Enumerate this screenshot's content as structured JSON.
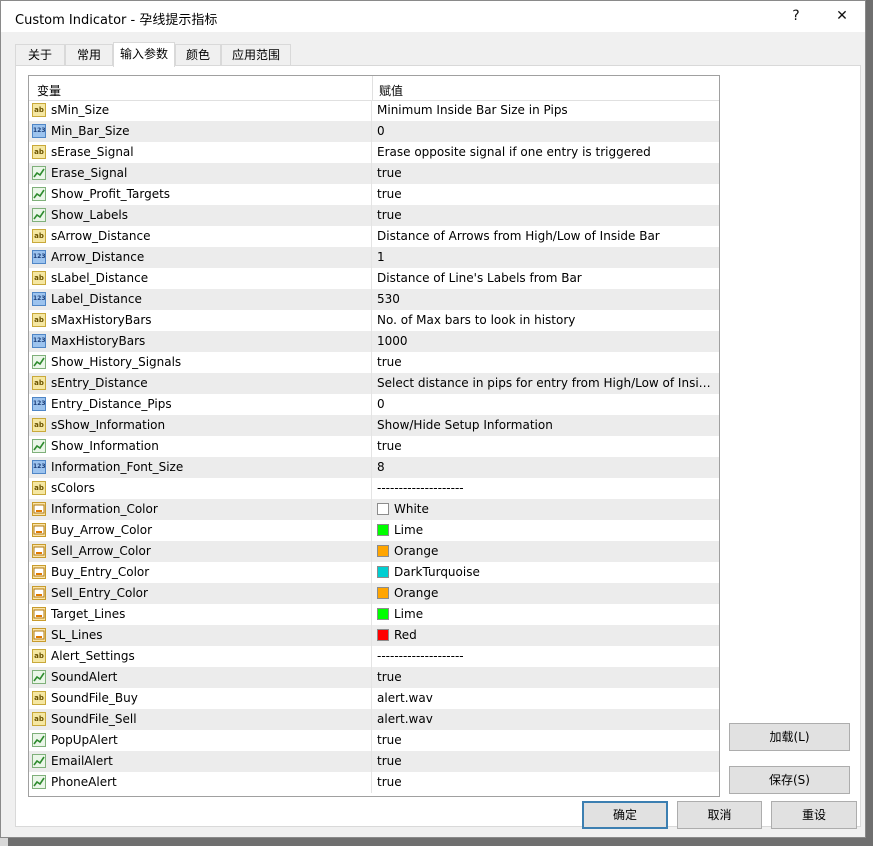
{
  "window": {
    "title": "Custom Indicator - 孕线提示指标",
    "help_label": "?",
    "close_label": "✕"
  },
  "tabs": [
    {
      "label": "关于"
    },
    {
      "label": "常用"
    },
    {
      "label": "输入参数",
      "active": true
    },
    {
      "label": "颜色"
    },
    {
      "label": "应用范围"
    }
  ],
  "grid": {
    "header": {
      "variable": "变量",
      "value": "赋值"
    },
    "rows": [
      {
        "type": "string",
        "name": "sMin_Size",
        "value": "Minimum Inside Bar Size in Pips"
      },
      {
        "type": "int",
        "name": "Min_Bar_Size",
        "value": "0"
      },
      {
        "type": "string",
        "name": "sErase_Signal",
        "value": "Erase opposite signal if one entry is triggered"
      },
      {
        "type": "bool",
        "name": "Erase_Signal",
        "value": "true"
      },
      {
        "type": "bool",
        "name": "Show_Profit_Targets",
        "value": "true"
      },
      {
        "type": "bool",
        "name": "Show_Labels",
        "value": "true"
      },
      {
        "type": "string",
        "name": "sArrow_Distance",
        "value": "Distance of Arrows from High/Low of Inside Bar"
      },
      {
        "type": "int",
        "name": "Arrow_Distance",
        "value": "1"
      },
      {
        "type": "string",
        "name": "sLabel_Distance",
        "value": "Distance of Line's Labels from Bar"
      },
      {
        "type": "int",
        "name": "Label_Distance",
        "value": "530"
      },
      {
        "type": "string",
        "name": "sMaxHistoryBars",
        "value": "No. of Max bars to look in history"
      },
      {
        "type": "int",
        "name": "MaxHistoryBars",
        "value": "1000"
      },
      {
        "type": "bool",
        "name": "Show_History_Signals",
        "value": "true"
      },
      {
        "type": "string",
        "name": "sEntry_Distance",
        "value": "Select distance in pips for entry from High/Low of Insid..."
      },
      {
        "type": "int",
        "name": "Entry_Distance_Pips",
        "value": "0"
      },
      {
        "type": "string",
        "name": "sShow_Information",
        "value": "Show/Hide Setup Information"
      },
      {
        "type": "bool",
        "name": "Show_Information",
        "value": "true"
      },
      {
        "type": "int",
        "name": "Information_Font_Size",
        "value": "8"
      },
      {
        "type": "string",
        "name": "sColors",
        "value": "--------------------"
      },
      {
        "type": "color",
        "name": "Information_Color",
        "value": "White",
        "swatch": "#ffffff"
      },
      {
        "type": "color",
        "name": "Buy_Arrow_Color",
        "value": "Lime",
        "swatch": "#00ff00"
      },
      {
        "type": "color",
        "name": "Sell_Arrow_Color",
        "value": "Orange",
        "swatch": "#ffa500"
      },
      {
        "type": "color",
        "name": "Buy_Entry_Color",
        "value": "DarkTurquoise",
        "swatch": "#00ced1"
      },
      {
        "type": "color",
        "name": "Sell_Entry_Color",
        "value": "Orange",
        "swatch": "#ffa500"
      },
      {
        "type": "color",
        "name": "Target_Lines",
        "value": "Lime",
        "swatch": "#00ff00"
      },
      {
        "type": "color",
        "name": "SL_Lines",
        "value": "Red",
        "swatch": "#ff0000"
      },
      {
        "type": "string",
        "name": "Alert_Settings",
        "value": "--------------------"
      },
      {
        "type": "bool",
        "name": "SoundAlert",
        "value": "true"
      },
      {
        "type": "string",
        "name": "SoundFile_Buy",
        "value": "alert.wav"
      },
      {
        "type": "string",
        "name": "SoundFile_Sell",
        "value": "alert.wav"
      },
      {
        "type": "bool",
        "name": "PopUpAlert",
        "value": "true"
      },
      {
        "type": "bool",
        "name": "EmailAlert",
        "value": "true"
      },
      {
        "type": "bool",
        "name": "PhoneAlert",
        "value": "true"
      }
    ]
  },
  "icons": {
    "string": "ab",
    "int": "123"
  },
  "buttons": {
    "load": "加载(L)",
    "save": "保存(S)",
    "ok": "确定",
    "cancel": "取消",
    "reset": "重设"
  }
}
